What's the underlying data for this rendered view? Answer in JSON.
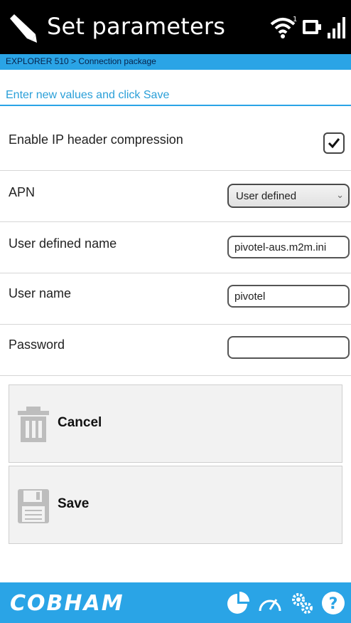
{
  "header": {
    "title": "Set parameters",
    "icons": [
      "edit-pen-icon",
      "wifi-icon",
      "battery-icon",
      "signal-bars-icon"
    ],
    "wifi_superscript": "1"
  },
  "breadcrumb": {
    "text": "EXPLORER 510 > Connection package"
  },
  "intro": {
    "text": "Enter new values and click Save"
  },
  "form": {
    "ip_compression": {
      "label": "Enable IP header compression",
      "checked": true
    },
    "apn": {
      "label": "APN",
      "selected": "User defined"
    },
    "user_defined_name": {
      "label": "User defined name",
      "value": "pivotel-aus.m2m.ini"
    },
    "user_name": {
      "label": "User name",
      "value": "pivotel"
    },
    "password": {
      "label": "Password",
      "value": ""
    }
  },
  "buttons": {
    "cancel": {
      "label": "Cancel",
      "icon": "trash-icon"
    },
    "save": {
      "label": "Save",
      "icon": "floppy-disk-icon"
    }
  },
  "footer": {
    "logo": "COBHAM",
    "icons": [
      "pie-chart-icon",
      "speedometer-icon",
      "settings-gears-icon",
      "help-icon"
    ]
  },
  "colors": {
    "accent": "#2aa4e6",
    "header_bg": "#000000",
    "button_bg": "#f2f2f2"
  }
}
